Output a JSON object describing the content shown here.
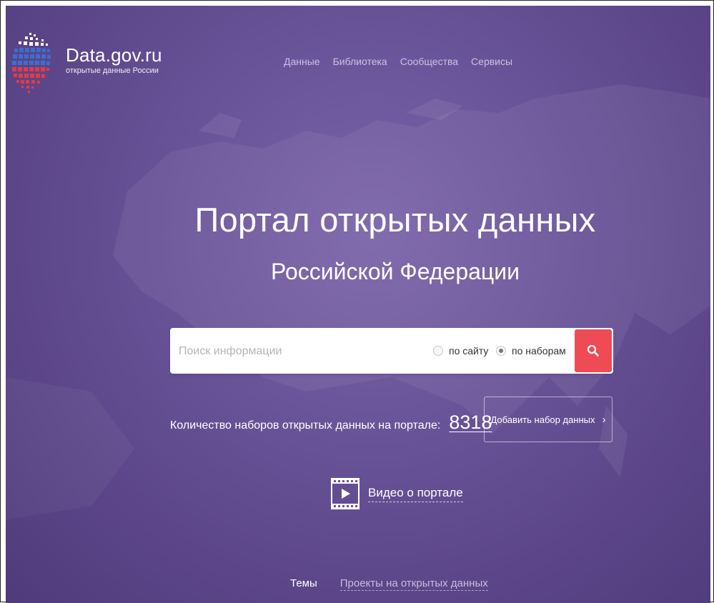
{
  "header": {
    "brand_title": "Data.gov.ru",
    "brand_subtitle": "открытые данные России",
    "nav": [
      "Данные",
      "Библиотека",
      "Сообщества",
      "Сервисы"
    ]
  },
  "hero": {
    "title": "Портал открытых данных",
    "subtitle": "Российской Федерации"
  },
  "search": {
    "placeholder": "Поиск информации",
    "option_site": "по сайту",
    "option_datasets": "по наборам",
    "selected_option": "по наборам",
    "button_icon": "search-icon"
  },
  "stats": {
    "label": "Количество наборов открытых данных на портале:",
    "count": "8318",
    "add_button": "Добавить набор данных",
    "add_button_icon": "chevron-right-icon"
  },
  "video": {
    "label": "Видео о портале",
    "icon": "video-play-icon"
  },
  "bottom_tabs": {
    "active": "Темы",
    "other": "Проекты на открытых данных"
  },
  "colors": {
    "background": "#6b559a",
    "search_button": "#ee4b55",
    "nav_text": "#c9c1e3"
  }
}
